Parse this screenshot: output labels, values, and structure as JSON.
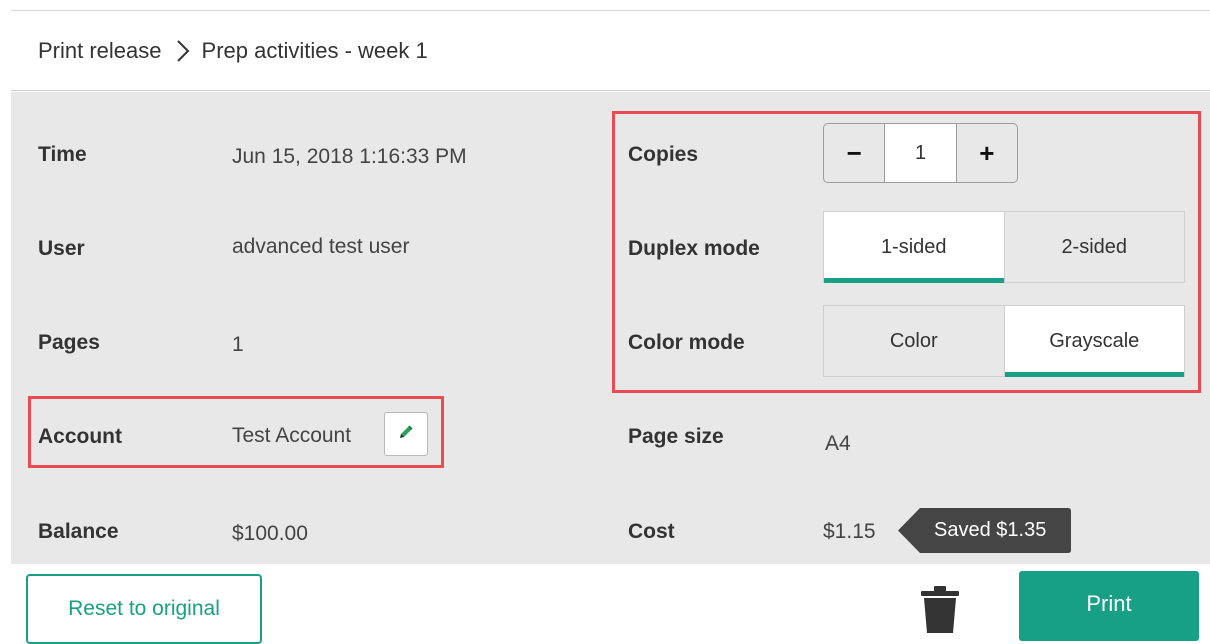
{
  "breadcrumb": {
    "parent": "Print release",
    "current": "Prep activities - week 1"
  },
  "details": {
    "time_label": "Time",
    "time_value": "Jun 15, 2018 1:16:33 PM",
    "user_label": "User",
    "user_value": "advanced test user",
    "pages_label": "Pages",
    "pages_value": "1",
    "account_label": "Account",
    "account_value": "Test Account",
    "balance_label": "Balance",
    "balance_value": "$100.00"
  },
  "options": {
    "copies_label": "Copies",
    "copies_value": "1",
    "copies_decrement": "−",
    "copies_increment": "+",
    "duplex_label": "Duplex mode",
    "duplex_options": [
      {
        "label": "1-sided",
        "selected": true
      },
      {
        "label": "2-sided",
        "selected": false
      }
    ],
    "color_label": "Color mode",
    "color_options": [
      {
        "label": "Color",
        "selected": false
      },
      {
        "label": "Grayscale",
        "selected": true
      }
    ],
    "page_size_label": "Page size",
    "page_size_value": "A4",
    "cost_label": "Cost",
    "cost_value": "$1.15",
    "saved_text": "Saved $1.35"
  },
  "actions": {
    "reset_label": "Reset to original",
    "print_label": "Print"
  },
  "icons": {
    "separator": "chevron-right-icon",
    "edit": "pencil-icon",
    "delete": "trash-icon"
  },
  "colors": {
    "accent": "#17a086",
    "highlight": "#ea4a52",
    "panel": "#e8e8e8",
    "tag": "#454545"
  }
}
